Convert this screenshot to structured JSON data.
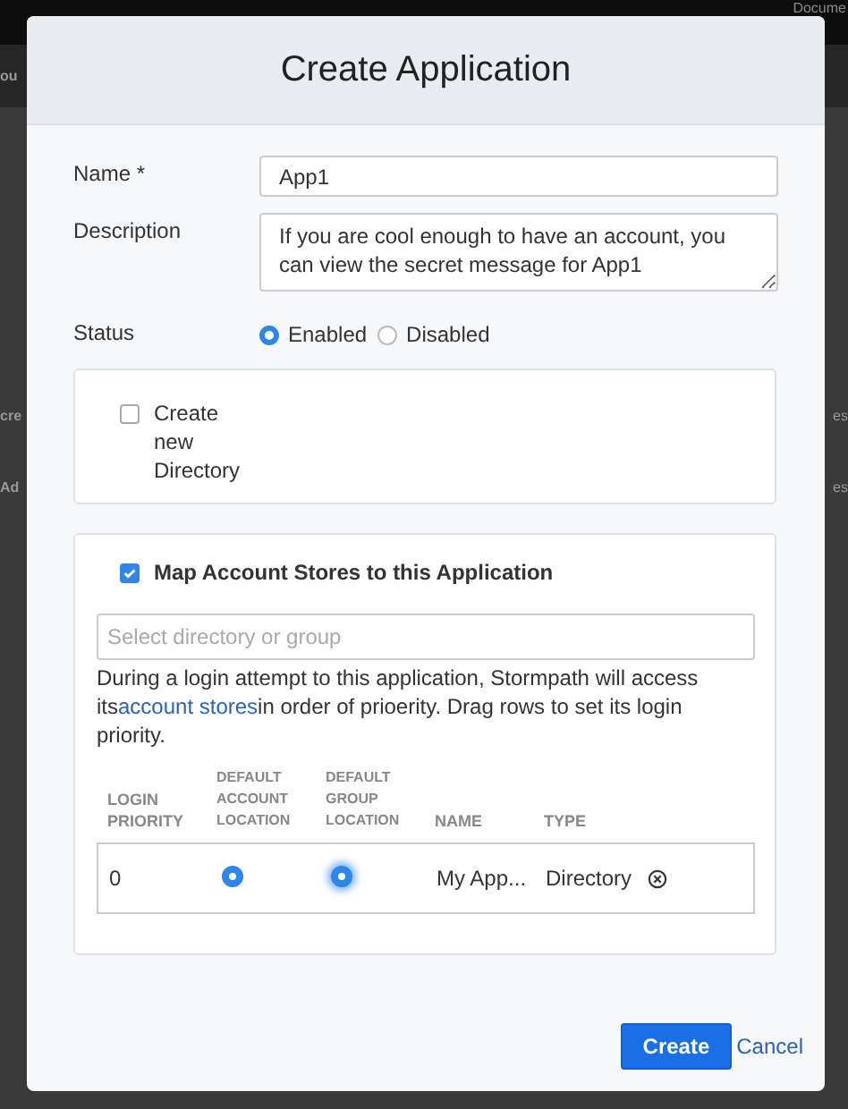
{
  "backdrop": {
    "top_right": "Docume",
    "left": [
      "ou",
      "cre",
      "Ad"
    ],
    "right": [
      "es",
      "es"
    ]
  },
  "dialog": {
    "title": "Create Application",
    "name": {
      "label": "Name *",
      "value": "App1"
    },
    "description": {
      "label": "Description",
      "value": "If you are cool enough to have an account, you can view the secret message for App1"
    },
    "status": {
      "label": "Status",
      "options": [
        {
          "label": "Enabled",
          "selected": true
        },
        {
          "label": "Disabled",
          "selected": false
        }
      ]
    },
    "create_directory": {
      "label": "Create new Directory",
      "checked": false
    },
    "map_stores": {
      "label": "Map Account Stores to this Application",
      "checked": true,
      "search": {
        "placeholder": "Select directory or group"
      },
      "help": {
        "before": "During a login attempt to this application, Stormpath will access its",
        "link": "account stores",
        "after": "in order of prioerity. Drag rows to set its login priority."
      },
      "table": {
        "columns": [
          "LOGIN PRIORITY",
          "DEFAULT ACCOUNT LOCATION",
          "DEFAULT GROUP LOCATION",
          "NAME",
          "TYPE"
        ],
        "rows": [
          {
            "priority": "0",
            "default_account": true,
            "default_group": true,
            "name": "My App...",
            "type": "Directory"
          }
        ]
      }
    },
    "buttons": {
      "primary": "Create",
      "secondary": "Cancel"
    }
  }
}
